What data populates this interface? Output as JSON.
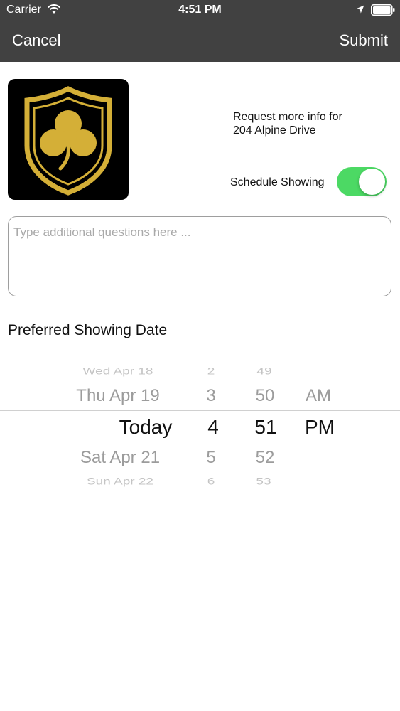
{
  "status_bar": {
    "carrier": "Carrier",
    "time": "4:51 PM"
  },
  "nav": {
    "cancel_label": "Cancel",
    "submit_label": "Submit"
  },
  "listing": {
    "request_line1": "Request more info for",
    "request_line2": "204 Alpine Drive"
  },
  "schedule": {
    "label": "Schedule Showing",
    "enabled": true
  },
  "questions": {
    "value": "",
    "placeholder": "Type additional questions here ..."
  },
  "preferred": {
    "title": "Preferred Showing Date"
  },
  "picker": {
    "dates": [
      "Wed Apr 18",
      "Thu Apr 19",
      "Today",
      "Sat Apr 21",
      "Sun Apr 22"
    ],
    "hours": [
      "2",
      "3",
      "4",
      "5",
      "6"
    ],
    "minutes": [
      "49",
      "50",
      "51",
      "52",
      "53"
    ],
    "periods": [
      "",
      "AM",
      "PM",
      "",
      ""
    ],
    "selected_index": 2
  },
  "colors": {
    "header_bg": "#414141",
    "toggle_on": "#4cd964",
    "logo_gold": "#d4af37",
    "logo_bg": "#000000"
  },
  "icons": {
    "wifi": "wifi-icon",
    "location": "location-arrow-icon",
    "battery": "battery-icon",
    "logo": "shamrock-shield-logo"
  }
}
